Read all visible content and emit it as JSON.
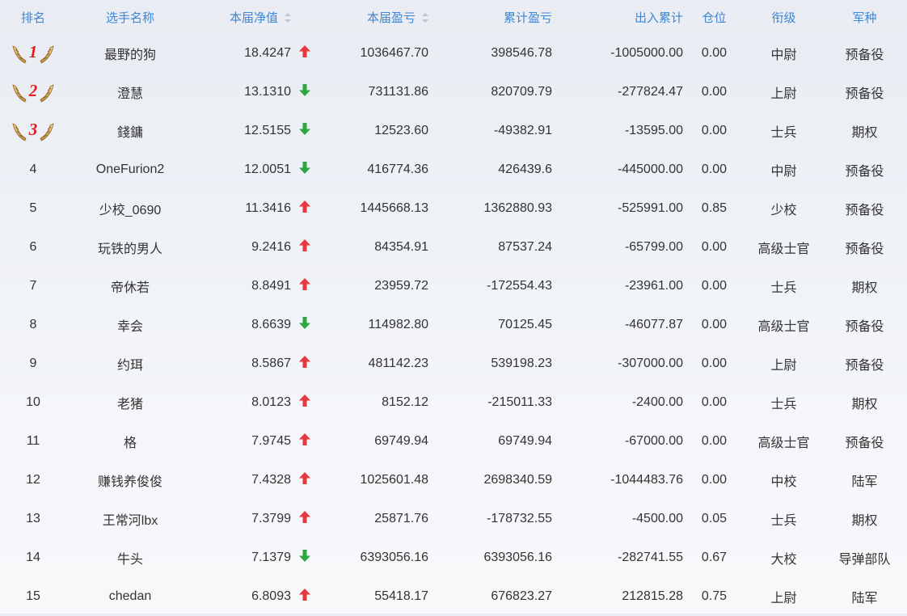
{
  "columns": {
    "rank": "排名",
    "name": "选手名称",
    "nav": "本届净值",
    "profit": "本届盈亏",
    "cumulative": "累计盈亏",
    "flow": "出入累计",
    "position": "仓位",
    "grade": "衔级",
    "branch": "军种"
  },
  "colors": {
    "header_text": "#3d86d8",
    "rank_medal_number": "#e02020",
    "trend_up": "#e8383d",
    "trend_down": "#2ca842"
  },
  "rows": [
    {
      "rank": "1",
      "medal": true,
      "name": "最野的狗",
      "nav": "18.4247",
      "trend": "up-arrow-icon",
      "profit": "1036467.70",
      "cumulative": "398546.78",
      "flow": "-1005000.00",
      "position": "0.00",
      "grade": "中尉",
      "branch": "预备役"
    },
    {
      "rank": "2",
      "medal": true,
      "name": "澄慧",
      "nav": "13.1310",
      "trend": "down-arrow-icon",
      "profit": "731131.86",
      "cumulative": "820709.79",
      "flow": "-277824.47",
      "position": "0.00",
      "grade": "上尉",
      "branch": "预备役"
    },
    {
      "rank": "3",
      "medal": true,
      "name": "錢鏞",
      "nav": "12.5155",
      "trend": "down-arrow-icon",
      "profit": "12523.60",
      "cumulative": "-49382.91",
      "flow": "-13595.00",
      "position": "0.00",
      "grade": "士兵",
      "branch": "期权"
    },
    {
      "rank": "4",
      "medal": false,
      "name": "OneFurion2",
      "nav": "12.0051",
      "trend": "down-arrow-icon",
      "profit": "416774.36",
      "cumulative": "426439.6",
      "flow": "-445000.00",
      "position": "0.00",
      "grade": "中尉",
      "branch": "预备役"
    },
    {
      "rank": "5",
      "medal": false,
      "name": "少校_0690",
      "nav": "11.3416",
      "trend": "up-arrow-icon",
      "profit": "1445668.13",
      "cumulative": "1362880.93",
      "flow": "-525991.00",
      "position": "0.85",
      "grade": "少校",
      "branch": "预备役"
    },
    {
      "rank": "6",
      "medal": false,
      "name": "玩铁的男人",
      "nav": "9.2416",
      "trend": "up-arrow-icon",
      "profit": "84354.91",
      "cumulative": "87537.24",
      "flow": "-65799.00",
      "position": "0.00",
      "grade": "高级士官",
      "branch": "预备役"
    },
    {
      "rank": "7",
      "medal": false,
      "name": "帝休若",
      "nav": "8.8491",
      "trend": "up-arrow-icon",
      "profit": "23959.72",
      "cumulative": "-172554.43",
      "flow": "-23961.00",
      "position": "0.00",
      "grade": "士兵",
      "branch": "期权"
    },
    {
      "rank": "8",
      "medal": false,
      "name": "幸会",
      "nav": "8.6639",
      "trend": "down-arrow-icon",
      "profit": "114982.80",
      "cumulative": "70125.45",
      "flow": "-46077.87",
      "position": "0.00",
      "grade": "高级士官",
      "branch": "预备役"
    },
    {
      "rank": "9",
      "medal": false,
      "name": "约珥",
      "nav": "8.5867",
      "trend": "up-arrow-icon",
      "profit": "481142.23",
      "cumulative": "539198.23",
      "flow": "-307000.00",
      "position": "0.00",
      "grade": "上尉",
      "branch": "预备役"
    },
    {
      "rank": "10",
      "medal": false,
      "name": "老猪",
      "nav": "8.0123",
      "trend": "up-arrow-icon",
      "profit": "8152.12",
      "cumulative": "-215011.33",
      "flow": "-2400.00",
      "position": "0.00",
      "grade": "士兵",
      "branch": "期权"
    },
    {
      "rank": "11",
      "medal": false,
      "name": "格",
      "nav": "7.9745",
      "trend": "up-arrow-icon",
      "profit": "69749.94",
      "cumulative": "69749.94",
      "flow": "-67000.00",
      "position": "0.00",
      "grade": "高级士官",
      "branch": "预备役"
    },
    {
      "rank": "12",
      "medal": false,
      "name": "赚钱养俊俊",
      "nav": "7.4328",
      "trend": "up-arrow-icon",
      "profit": "1025601.48",
      "cumulative": "2698340.59",
      "flow": "-1044483.76",
      "position": "0.00",
      "grade": "中校",
      "branch": "陆军"
    },
    {
      "rank": "13",
      "medal": false,
      "name": "王常河lbx",
      "nav": "7.3799",
      "trend": "up-arrow-icon",
      "profit": "25871.76",
      "cumulative": "-178732.55",
      "flow": "-4500.00",
      "position": "0.05",
      "grade": "士兵",
      "branch": "期权"
    },
    {
      "rank": "14",
      "medal": false,
      "name": "牛头",
      "nav": "7.1379",
      "trend": "down-arrow-icon",
      "profit": "6393056.16",
      "cumulative": "6393056.16",
      "flow": "-282741.55",
      "position": "0.67",
      "grade": "大校",
      "branch": "导弹部队"
    },
    {
      "rank": "15",
      "medal": false,
      "name": "chedan",
      "nav": "6.8093",
      "trend": "up-arrow-icon",
      "profit": "55418.17",
      "cumulative": "676823.27",
      "flow": "212815.28",
      "position": "0.75",
      "grade": "上尉",
      "branch": "陆军"
    }
  ]
}
